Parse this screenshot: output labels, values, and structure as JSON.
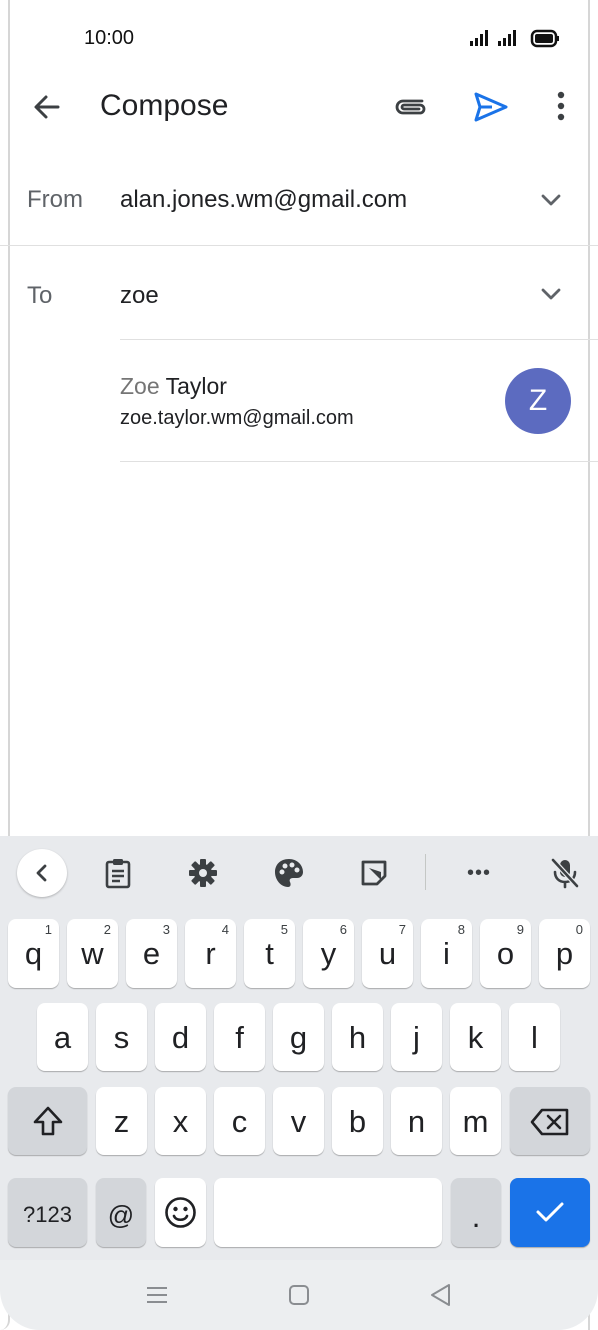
{
  "status_bar": {
    "time": "10:00",
    "icons": [
      "signal-icon",
      "signal-icon",
      "battery-icon"
    ]
  },
  "app_bar": {
    "title": "Compose",
    "icons": [
      "back-arrow-icon",
      "attach-icon",
      "send-icon",
      "more-vert-icon"
    ],
    "send_color": "#1a73e8"
  },
  "from": {
    "label": "From",
    "value": "alan.jones.wm@gmail.com"
  },
  "to": {
    "label": "To",
    "value": "zoe"
  },
  "suggestion": {
    "match": "Zoe",
    "rest": " Taylor",
    "email": "zoe.taylor.wm@gmail.com",
    "avatar_letter": "Z",
    "avatar_color": "#5c6bc0"
  },
  "keyboard": {
    "toolbar": [
      "chevron-left-icon",
      "clipboard-icon",
      "gear-icon",
      "palette-icon",
      "sticker-icon",
      "more-horiz-icon",
      "mic-off-icon"
    ],
    "more_label": "•••",
    "row1": [
      {
        "ch": "q",
        "n": "1"
      },
      {
        "ch": "w",
        "n": "2"
      },
      {
        "ch": "e",
        "n": "3"
      },
      {
        "ch": "r",
        "n": "4"
      },
      {
        "ch": "t",
        "n": "5"
      },
      {
        "ch": "y",
        "n": "6"
      },
      {
        "ch": "u",
        "n": "7"
      },
      {
        "ch": "i",
        "n": "8"
      },
      {
        "ch": "o",
        "n": "9"
      },
      {
        "ch": "p",
        "n": "0"
      }
    ],
    "row2": [
      "a",
      "s",
      "d",
      "f",
      "g",
      "h",
      "j",
      "k",
      "l"
    ],
    "row3": [
      "z",
      "x",
      "c",
      "v",
      "b",
      "n",
      "m"
    ],
    "bottom": {
      "symbols": "?123",
      "at": "@",
      "period": "."
    },
    "accent": "#1a73e8"
  },
  "nav_bar": {
    "icons": [
      "recents-icon",
      "home-icon",
      "back-triangle-icon"
    ]
  }
}
